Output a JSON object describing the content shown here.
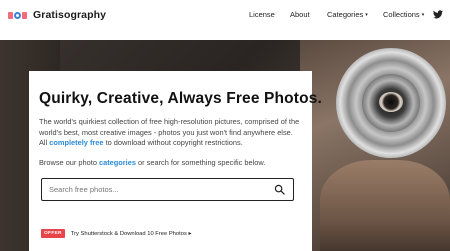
{
  "header": {
    "logo_text": "Gratisography",
    "nav": {
      "license": "License",
      "about": "About",
      "categories": "Categories",
      "collections": "Collections"
    },
    "dropdown_glyph": "▾",
    "twitter_icon": "twitter-icon"
  },
  "hero": {
    "title": "Quirky, Creative, Always Free Photos.",
    "description_1": "The world's quirkiest collection of free high-resolution pictures, comprised of the world's best, most creative images - photos you just won't find anywhere else. All ",
    "description_link": "completely free",
    "description_2": " to download without copyright restrictions.",
    "browse_1": "Browse our photo ",
    "browse_link": "categories",
    "browse_2": " or search for something specific below.",
    "search": {
      "placeholder": "Search free photos...",
      "value": ""
    },
    "promo": {
      "badge": "OFFER",
      "text": "Try Shutterstock & Download 10 Free Photos ▸"
    }
  },
  "colors": {
    "accent_link": "#2a8bd8",
    "offer_badge": "#e8454b",
    "logo_pink": "#f46b7e",
    "logo_blue": "#3c7fdc"
  }
}
